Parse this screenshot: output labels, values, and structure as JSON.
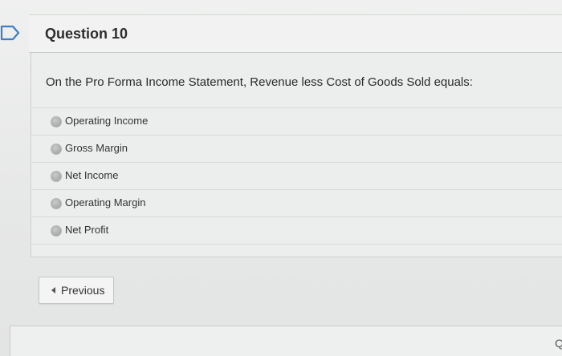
{
  "question": {
    "title": "Question 10",
    "text": "On the Pro Forma Income Statement, Revenue less Cost of Goods Sold equals:",
    "options": [
      {
        "label": "Operating Income"
      },
      {
        "label": "Gross Margin"
      },
      {
        "label": "Net Income"
      },
      {
        "label": "Operating Margin"
      },
      {
        "label": "Net Profit"
      }
    ]
  },
  "navigation": {
    "previous_label": "Previous"
  },
  "footer": {
    "corner_text": "Q"
  },
  "colors": {
    "flag_blue": "#3d7ec8",
    "background": "#e9eaea"
  },
  "icons": {
    "unanswered_flag": "flag-icon",
    "previous_arrow": "caret-left-icon"
  }
}
